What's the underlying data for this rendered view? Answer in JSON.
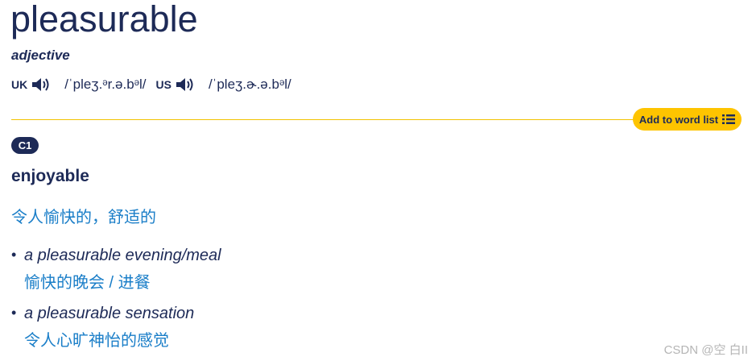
{
  "entry": {
    "headword": "pleasurable",
    "part_of_speech": "adjective"
  },
  "pronunciations": [
    {
      "region": "UK",
      "icon": "speaker-icon",
      "ipa": "/ˈpleʒ.ᵊr.ə.bᵊl/"
    },
    {
      "region": "US",
      "icon": "speaker-icon",
      "ipa": "/ˈpleʒ.ɚ.ə.bᵊl/"
    }
  ],
  "add_to_word_list": {
    "label": "Add to word list",
    "icon": "list-icon"
  },
  "sense": {
    "level": "C1",
    "definition": "enjoyable",
    "translation": "令人愉快的，舒适的",
    "examples": [
      {
        "text": "a pleasurable evening/meal",
        "translation": "愉快的晚会 / 进餐"
      },
      {
        "text": "a pleasurable sensation",
        "translation": "令人心旷神怡的感觉"
      }
    ]
  },
  "watermark": "CSDN @空 白II",
  "colors": {
    "navy": "#1d2a57",
    "translation_blue": "#1a7ec8",
    "accent_yellow": "#fec400"
  }
}
